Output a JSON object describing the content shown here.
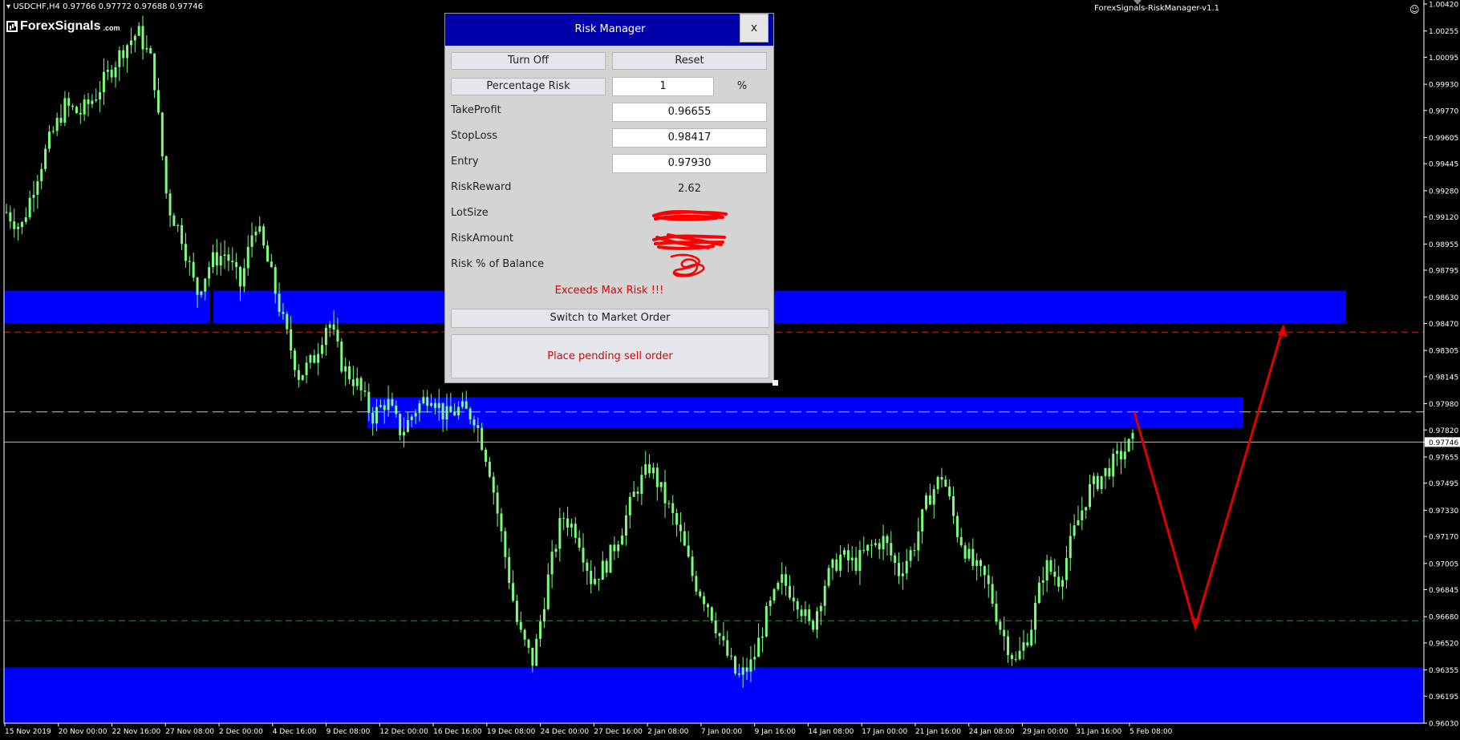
{
  "chart_header": {
    "symbol_info": "USDCHF,H4  0.97766 0.97772 0.97688 0.97746",
    "brand_name": "ForexSignals",
    "brand_suffix": ".com",
    "indicator_name": "ForexSignals-RiskManager-v1.1"
  },
  "colors": {
    "background": "#000000",
    "candle": "#7cfc7c",
    "zone": "#0000ff",
    "panel_title": "#0000a8",
    "warning": "#e00000",
    "arrow": "#e00000"
  },
  "chart_data": {
    "type": "candlestick",
    "symbol": "USDCHF",
    "timeframe": "H4",
    "ylim": [
      0.9603,
      1.0042
    ],
    "price_ticks": [
      "1.00420",
      "1.00255",
      "1.00095",
      "0.99930",
      "0.99770",
      "0.99605",
      "0.99445",
      "0.99280",
      "0.99120",
      "0.98955",
      "0.98795",
      "0.98630",
      "0.98470",
      "0.98305",
      "0.98145",
      "0.97980",
      "0.97820",
      "0.97746",
      "0.97655",
      "0.97495",
      "0.97330",
      "0.97170",
      "0.97005",
      "0.96845",
      "0.96680",
      "0.96520",
      "0.96355",
      "0.96195",
      "0.96030"
    ],
    "current_price": "0.97746",
    "time_ticks": [
      "15 Nov 2019",
      "20 Nov 00:00",
      "22 Nov 16:00",
      "27 Nov 08:00",
      "2 Dec 00:00",
      "4 Dec 16:00",
      "9 Dec 08:00",
      "12 Dec 00:00",
      "16 Dec 16:00",
      "19 Dec 08:00",
      "24 Dec 00:00",
      "27 Dec 16:00",
      "2 Jan 08:00",
      "7 Jan 00:00",
      "9 Jan 16:00",
      "14 Jan 08:00",
      "17 Jan 00:00",
      "21 Jan 16:00",
      "24 Jan 08:00",
      "29 Jan 00:00",
      "31 Jan 16:00",
      "5 Feb 08:00"
    ],
    "price_path": [
      0.9915,
      0.9905,
      0.9935,
      0.996,
      0.998,
      0.9975,
      0.9985,
      1.0,
      1.0015,
      1.0025,
      1.0005,
      0.992,
      0.99,
      0.9865,
      0.9885,
      0.989,
      0.987,
      0.991,
      0.988,
      0.9845,
      0.9815,
      0.9825,
      0.985,
      0.982,
      0.981,
      0.979,
      0.98,
      0.978,
      0.9795,
      0.9805,
      0.979,
      0.9795,
      0.979,
      0.976,
      0.971,
      0.966,
      0.964,
      0.969,
      0.973,
      0.972,
      0.969,
      0.97,
      0.972,
      0.9745,
      0.976,
      0.974,
      0.972,
      0.969,
      0.9675,
      0.965,
      0.963,
      0.964,
      0.967,
      0.969,
      0.968,
      0.966,
      0.969,
      0.9705,
      0.97,
      0.971,
      0.9715,
      0.9695,
      0.971,
      0.974,
      0.9755,
      0.972,
      0.97,
      0.969,
      0.966,
      0.964,
      0.966,
      0.97,
      0.969,
      0.972,
      0.9745,
      0.9755,
      0.9765,
      0.9775
    ],
    "zones": [
      {
        "name": "upper-resistance",
        "from": 0.9847,
        "to": 0.9867
      },
      {
        "name": "mid-zone",
        "from": 0.9783,
        "to": 0.9802
      },
      {
        "name": "lower-support",
        "from": 0.9603,
        "to": 0.9637
      }
    ],
    "levels": [
      {
        "name": "stop-loss",
        "price": 0.98417,
        "color": "#cc2020"
      },
      {
        "name": "entry",
        "price": 0.9793,
        "color": "#c8d86a"
      },
      {
        "name": "take-profit",
        "price": 0.96655,
        "color": "#2e8b2e"
      },
      {
        "name": "current",
        "price": 0.97746,
        "color": "#bbbbbb"
      }
    ]
  },
  "risk_manager": {
    "title": "Risk Manager",
    "close_label": "x",
    "turn_off_label": "Turn Off",
    "reset_label": "Reset",
    "risk_mode_label": "Percentage Risk",
    "risk_value": "1",
    "risk_unit": "%",
    "take_profit_label": "TakeProfit",
    "take_profit_value": "0.96655",
    "stop_loss_label": "StopLoss",
    "stop_loss_value": "0.98417",
    "entry_label": "Entry",
    "entry_value": "0.97930",
    "risk_reward_label": "RiskReward",
    "risk_reward_value": "2.62",
    "lot_size_label": "LotSize",
    "risk_amount_label": "RiskAmount",
    "risk_balance_label": "Risk % of Balance",
    "warning_text": "Exceeds Max Risk !!!",
    "switch_label": "Switch to Market Order",
    "order_label": "Place pending sell order"
  }
}
